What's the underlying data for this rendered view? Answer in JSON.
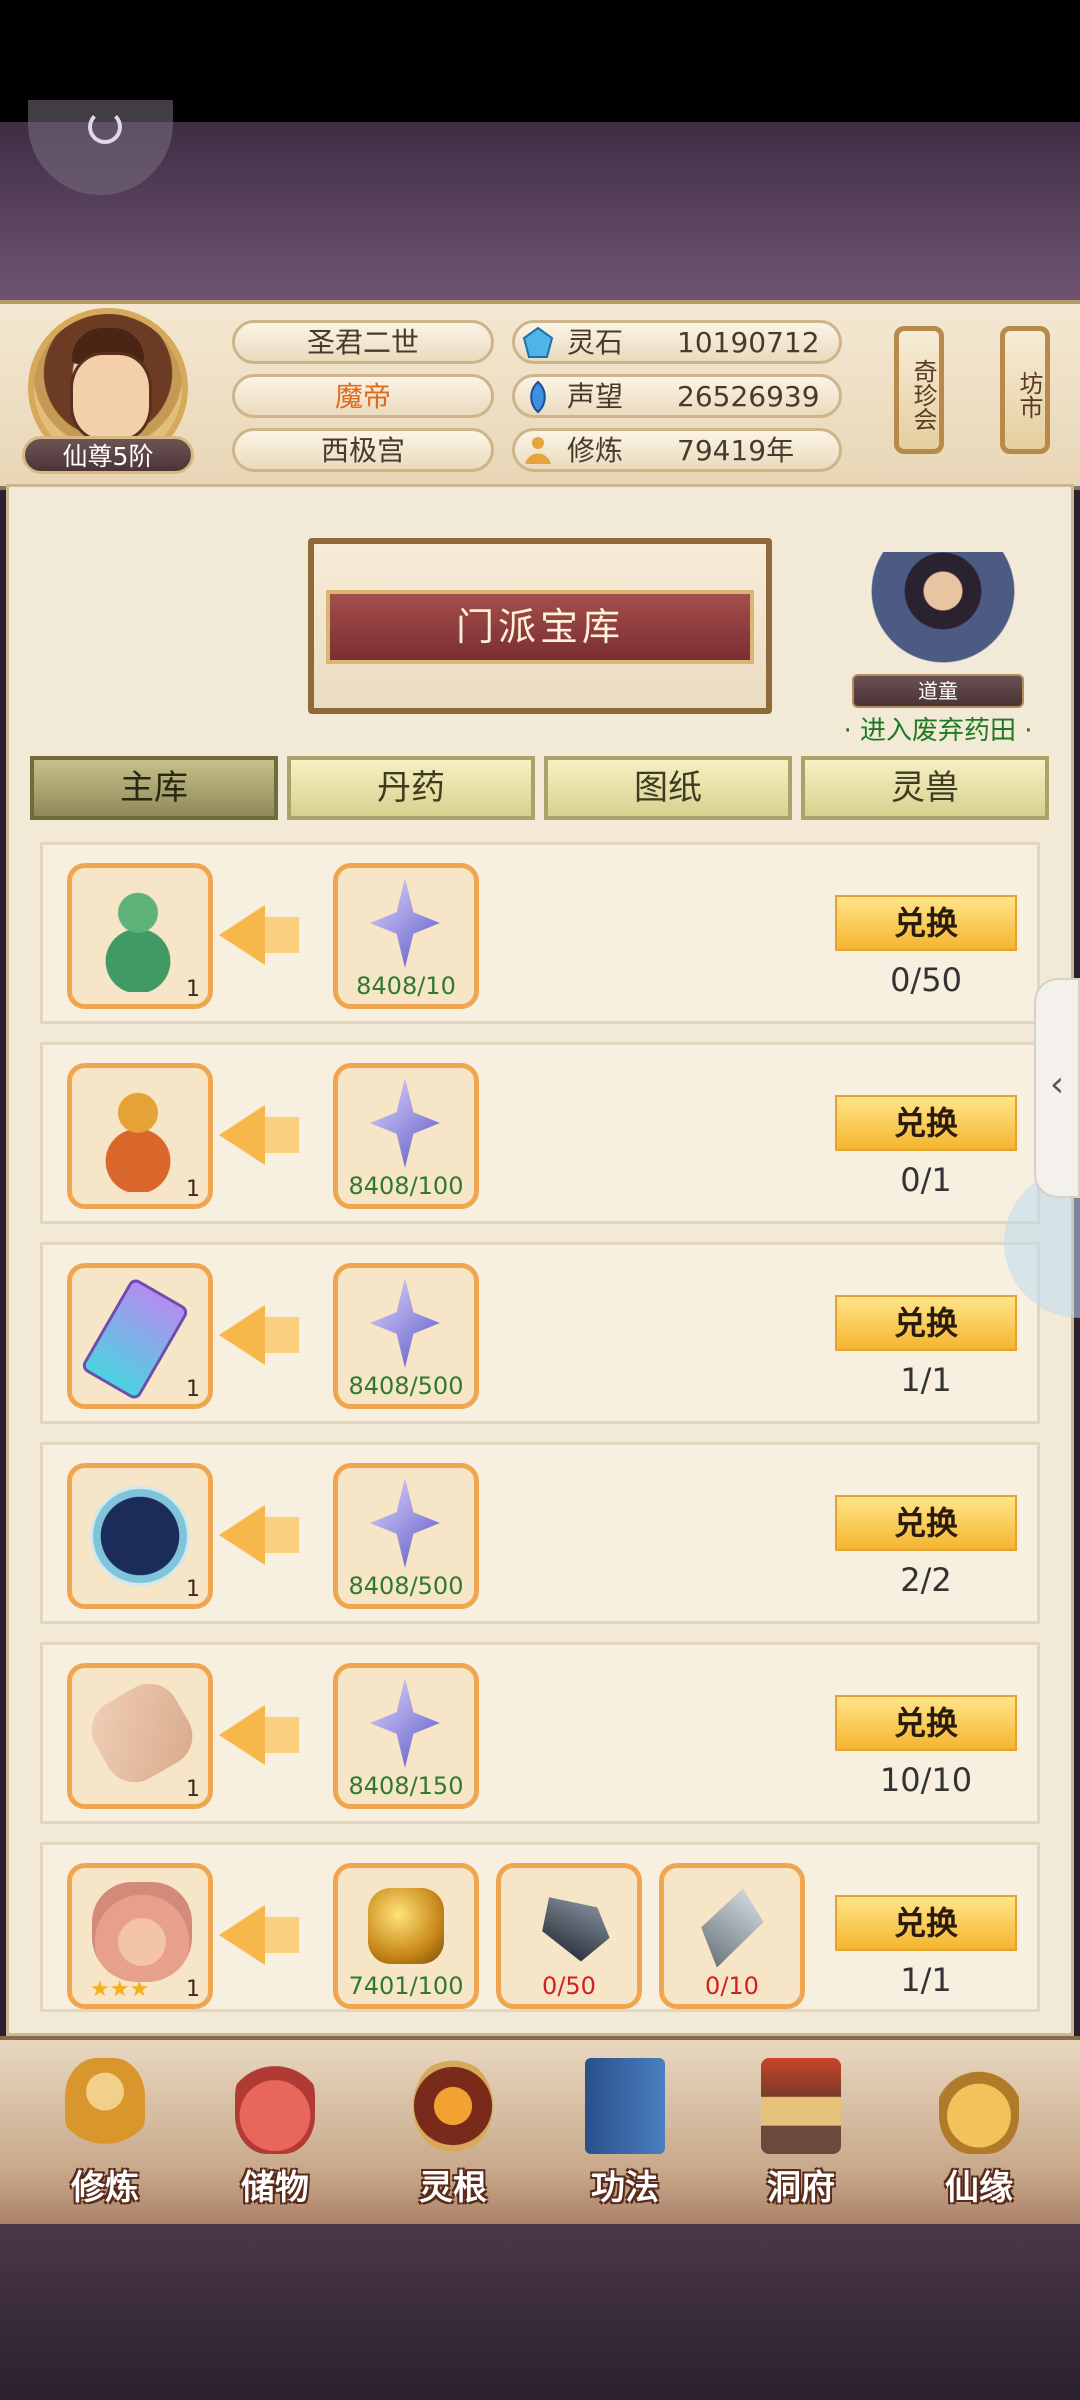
{
  "player": {
    "rank": "仙尊5阶",
    "name": "圣君二世",
    "title": "魔帝",
    "sect": "西极宫"
  },
  "stats": [
    {
      "label": "灵石",
      "value": "10190712",
      "icon": "spirit-stone-icon"
    },
    {
      "label": "声望",
      "value": "26526939",
      "icon": "reputation-icon"
    },
    {
      "label": "修炼",
      "value": "79419年",
      "icon": "cultivation-icon"
    }
  ],
  "side_buttons": [
    "奇珍会",
    "坊市"
  ],
  "banner": {
    "title": "门派宝库"
  },
  "npc": {
    "name": "道童",
    "link": "· 进入废弃药田 ·"
  },
  "tabs": [
    "主库",
    "丹药",
    "图纸",
    "灵兽"
  ],
  "exchange_label": "兑换",
  "rows": [
    {
      "item": "green-gourd",
      "count": "1",
      "costs": [
        {
          "icon": "star-shard-icon",
          "progress": "8408/10",
          "enough": true
        }
      ],
      "quota": "0/50"
    },
    {
      "item": "orange-gourd",
      "count": "1",
      "costs": [
        {
          "icon": "star-shard-icon",
          "progress": "8408/100",
          "enough": true
        }
      ],
      "quota": "0/1"
    },
    {
      "item": "jade-token",
      "count": "1",
      "costs": [
        {
          "icon": "star-shard-icon",
          "progress": "8408/500",
          "enough": true
        }
      ],
      "quota": "1/1"
    },
    {
      "item": "star-orb",
      "count": "1",
      "costs": [
        {
          "icon": "star-shard-icon",
          "progress": "8408/500",
          "enough": true
        }
      ],
      "quota": "2/2"
    },
    {
      "item": "scroll",
      "count": "1",
      "costs": [
        {
          "icon": "star-shard-icon",
          "progress": "8408/150",
          "enough": true
        }
      ],
      "quota": "10/10"
    },
    {
      "item": "censer",
      "count": "1",
      "stars": "★★★",
      "costs": [
        {
          "icon": "gold-ore-icon",
          "progress": "7401/100",
          "enough": true
        },
        {
          "icon": "dark-ore-icon",
          "progress": "0/50",
          "enough": false
        },
        {
          "icon": "silver-ore-icon",
          "progress": "0/10",
          "enough": false
        }
      ],
      "quota": "1/1"
    }
  ],
  "nav": [
    "修炼",
    "储物",
    "灵根",
    "功法",
    "洞府",
    "仙缘"
  ],
  "colors": {
    "accent": "#f5b52f",
    "progress_ok": "#2f7a2f",
    "progress_low": "#d02020",
    "link": "#1e7a1e"
  }
}
